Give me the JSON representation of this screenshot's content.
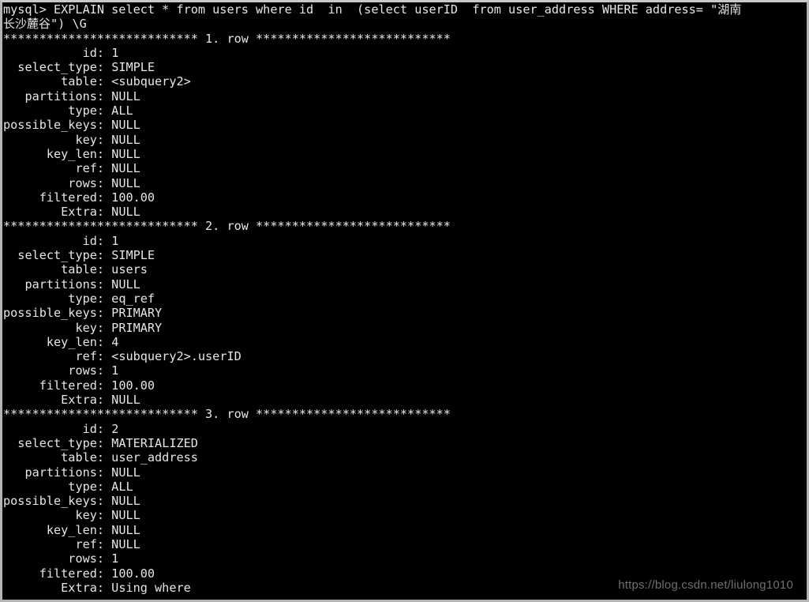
{
  "window": {
    "kind": "mysql-cli-terminal",
    "background_color": "#000000",
    "foreground_color": "#e6e6e6",
    "border_color": "#b4b4b4"
  },
  "terminal": {
    "prompt": "mysql>",
    "command_line_1": "mysql> EXPLAIN select * from users where id  in  (select userID  from user_address WHERE address= \"湖南",
    "command_line_2": "长沙麓谷\") \\G",
    "command_prefix": "mysql> EXPLAIN select * from users where id  in  (select userID  from user_address WHERE address= \"",
    "command_value_han_1": "湖南",
    "command_value_han_2": "长沙麓谷",
    "command_suffix": "\") \\G",
    "separator_left": "***************************",
    "separator_right": "***************************",
    "rows": [
      {
        "label": "1. row",
        "separator": "*************************** 1. row ***************************",
        "fields": [
          {
            "name": "id",
            "value": "1"
          },
          {
            "name": "select_type",
            "value": "SIMPLE"
          },
          {
            "name": "table",
            "value": "<subquery2>"
          },
          {
            "name": "partitions",
            "value": "NULL"
          },
          {
            "name": "type",
            "value": "ALL"
          },
          {
            "name": "possible_keys",
            "value": "NULL"
          },
          {
            "name": "key",
            "value": "NULL"
          },
          {
            "name": "key_len",
            "value": "NULL"
          },
          {
            "name": "ref",
            "value": "NULL"
          },
          {
            "name": "rows",
            "value": "NULL"
          },
          {
            "name": "filtered",
            "value": "100.00"
          },
          {
            "name": "Extra",
            "value": "NULL"
          }
        ]
      },
      {
        "label": "2. row",
        "separator": "*************************** 2. row ***************************",
        "fields": [
          {
            "name": "id",
            "value": "1"
          },
          {
            "name": "select_type",
            "value": "SIMPLE"
          },
          {
            "name": "table",
            "value": "users"
          },
          {
            "name": "partitions",
            "value": "NULL"
          },
          {
            "name": "type",
            "value": "eq_ref"
          },
          {
            "name": "possible_keys",
            "value": "PRIMARY"
          },
          {
            "name": "key",
            "value": "PRIMARY"
          },
          {
            "name": "key_len",
            "value": "4"
          },
          {
            "name": "ref",
            "value": "<subquery2>.userID"
          },
          {
            "name": "rows",
            "value": "1"
          },
          {
            "name": "filtered",
            "value": "100.00"
          },
          {
            "name": "Extra",
            "value": "NULL"
          }
        ]
      },
      {
        "label": "3. row",
        "separator": "*************************** 3. row ***************************",
        "fields": [
          {
            "name": "id",
            "value": "2"
          },
          {
            "name": "select_type",
            "value": "MATERIALIZED"
          },
          {
            "name": "table",
            "value": "user_address"
          },
          {
            "name": "partitions",
            "value": "NULL"
          },
          {
            "name": "type",
            "value": "ALL"
          },
          {
            "name": "possible_keys",
            "value": "NULL"
          },
          {
            "name": "key",
            "value": "NULL"
          },
          {
            "name": "key_len",
            "value": "NULL"
          },
          {
            "name": "ref",
            "value": "NULL"
          },
          {
            "name": "rows",
            "value": "1"
          },
          {
            "name": "filtered",
            "value": "100.00"
          },
          {
            "name": "Extra",
            "value": "Using where"
          }
        ]
      }
    ]
  },
  "watermark": {
    "text": "https://blog.csdn.net/liulong1010",
    "color": "#6e6e6e"
  }
}
